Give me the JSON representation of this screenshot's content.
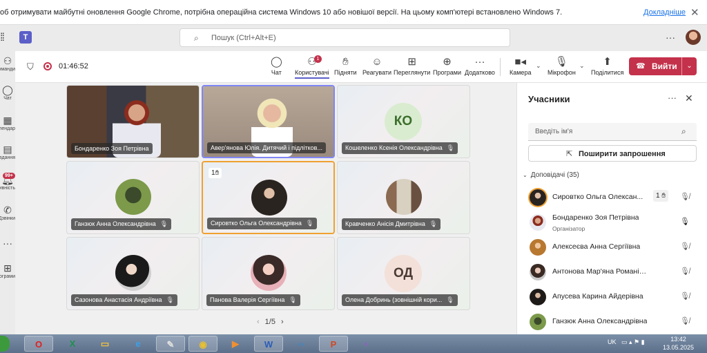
{
  "chrome_infobar": {
    "message": "об отримувати майбутні оновлення Google Chrome, потрібна операційна система Windows 10 або новішої версії. На цьому комп'ютері встановлено Windows 7.",
    "link": "Докладніше",
    "close_icon": "close-icon"
  },
  "topbar": {
    "search_placeholder": "Пошук (Ctrl+Alt+E)",
    "more": "···"
  },
  "rail": {
    "items": [
      {
        "label": "Команди",
        "icon": "teams-icon"
      },
      {
        "label": "Чат",
        "icon": "chat-icon"
      },
      {
        "label": "Календар",
        "icon": "calendar-icon"
      },
      {
        "label": "Завдання",
        "icon": "assignments-icon"
      },
      {
        "label": "Активність",
        "icon": "activity-icon"
      },
      {
        "label": "Дзвінки",
        "icon": "calls-icon"
      },
      {
        "label": "···",
        "icon": "more-icon"
      },
      {
        "label": "Програми",
        "icon": "apps-icon"
      }
    ],
    "activity_badge": "99+"
  },
  "meeting_toolbar": {
    "timer": "01:46:52",
    "people_badge": "1",
    "buttons": [
      {
        "label": "Чат",
        "icon": "chat-icon"
      },
      {
        "label": "Користувачі",
        "icon": "people-icon"
      },
      {
        "label": "Підняти",
        "icon": "raise-hand-icon"
      },
      {
        "label": "Реагувати",
        "icon": "react-icon"
      },
      {
        "label": "Переглянути",
        "icon": "view-icon"
      },
      {
        "label": "Програми",
        "icon": "apps-icon"
      },
      {
        "label": "Додатково",
        "icon": "more-icon"
      },
      {
        "label": "Камера",
        "icon": "camera-icon"
      },
      {
        "label": "Мікрофон",
        "icon": "mic-icon"
      },
      {
        "label": "Поділитися",
        "icon": "share-icon"
      }
    ],
    "leave_label": "Вийти"
  },
  "stage": {
    "tiles": [
      {
        "name": "Бондаренко Зоя Петрівна",
        "kind": "video"
      },
      {
        "name": "Авер'янова Юлія. Дитячий і підлітков...",
        "kind": "video"
      },
      {
        "name": "Кошеленко Ксенія Олександрівна",
        "initials": "КО",
        "color": "#d9ecd0",
        "text_color": "#3b6e2a"
      },
      {
        "name": "Ганзюк Анна Олександрівна",
        "kind": "photo"
      },
      {
        "name": "Сировтко Ольга Олександрівна",
        "kind": "photo",
        "hand": "1"
      },
      {
        "name": "Кравченко Анісія Дмитрівна",
        "kind": "photo"
      },
      {
        "name": "Сазонова Анастасія Андріївна",
        "kind": "photo"
      },
      {
        "name": "Панова Валерія Сергіївна",
        "kind": "photo"
      },
      {
        "name": "Олена Добринь (зовнішній кори...",
        "initials": "ОД",
        "color": "#f3e0d8",
        "text_color": "#4a3a36"
      }
    ],
    "pager": "1/5"
  },
  "participants": {
    "title": "Учасники",
    "search_placeholder": "Введіть ім'я",
    "invite_label": "Поширити запрошення",
    "group_label": "Доповідачі (35)",
    "people": [
      {
        "name": "Сировтко Ольга Олексан...",
        "hand": "1",
        "mic": "muted"
      },
      {
        "name": "Бондаренко Зоя Петрівна",
        "role": "Організатор",
        "mic": "on"
      },
      {
        "name": "Алексеєва Анна Сергіївна",
        "mic": "muted"
      },
      {
        "name": "Антонова Мар'яна Романівна",
        "mic": "muted"
      },
      {
        "name": "Апусева Карина Айдерівна",
        "mic": "muted"
      },
      {
        "name": "Ганзюк Анна Олександрівна",
        "mic": "muted"
      }
    ]
  },
  "taskbar": {
    "apps": [
      "opera-icon",
      "excel-icon",
      "explorer-icon",
      "ie-icon",
      "paint-icon",
      "chrome-icon",
      "media-icon",
      "word-icon",
      "teamviewer-icon",
      "powerpoint-icon",
      "tor-icon"
    ],
    "lang": "UK",
    "time": "13:42",
    "date": "13.05.2025"
  }
}
